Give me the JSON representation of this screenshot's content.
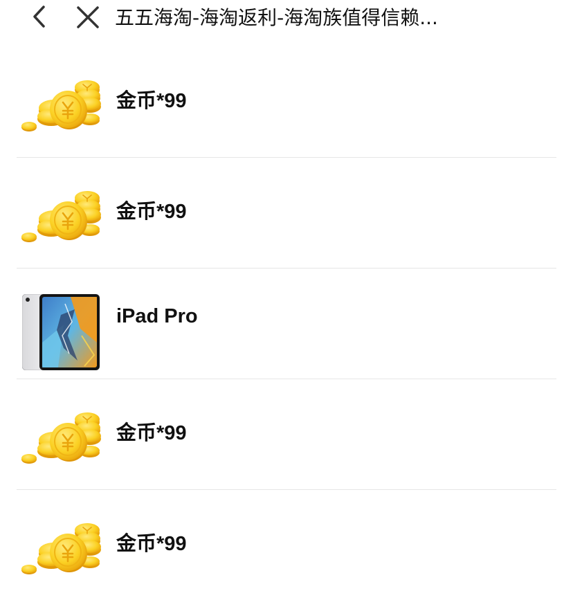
{
  "header": {
    "back_icon": "chevron-left-icon",
    "close_icon": "close-icon",
    "title": "五五海淘-海淘返利-海淘族值得信赖..."
  },
  "colors": {
    "coin_gold": "#f9cf1e",
    "coin_shadow": "#e6a50a",
    "divider": "#e6e6e6",
    "text": "#111111"
  },
  "rewards": [
    {
      "label": "金币*99",
      "icon": "gold-coins-icon"
    },
    {
      "label": "金币*99",
      "icon": "gold-coins-icon"
    },
    {
      "label": "iPad Pro",
      "icon": "ipad-pro-image"
    },
    {
      "label": "金币*99",
      "icon": "gold-coins-icon"
    },
    {
      "label": "金币*99",
      "icon": "gold-coins-icon"
    }
  ]
}
